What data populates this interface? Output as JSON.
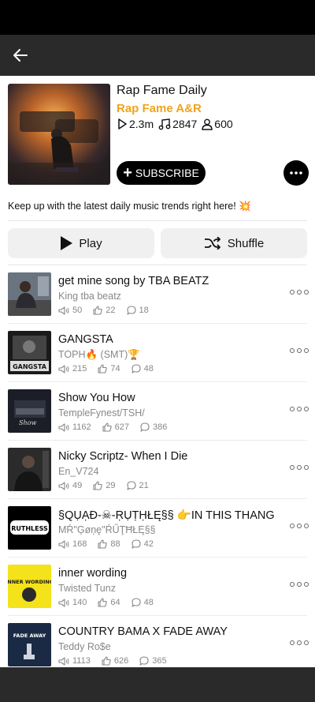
{
  "playlist": {
    "title": "Rap Fame Daily",
    "owner": "Rap Fame A&R",
    "plays": "2.3m",
    "tracks": "2847",
    "followers": "600",
    "subscribe_label": "SUBSCRIBE",
    "description": "Keep up with the latest daily music trends right here! 💥"
  },
  "actions": {
    "play_label": "Play",
    "shuffle_label": "Shuffle"
  },
  "songs": [
    {
      "title": "get mine song by TBA BEATZ",
      "artist": "King tba beatz",
      "plays": "50",
      "likes": "22",
      "comments": "18"
    },
    {
      "title": "GANGSTA",
      "artist": "TOPH🔥 (SMT)🏆",
      "plays": "215",
      "likes": "74",
      "comments": "48"
    },
    {
      "title": "Show You How",
      "artist": "TempleFynest/TSH/",
      "plays": "1162",
      "likes": "627",
      "comments": "386"
    },
    {
      "title": "Nicky Scriptz- When I Die",
      "artist": "En_V724",
      "plays": "49",
      "likes": "29",
      "comments": "21"
    },
    {
      "title": "§QỤẠĐ-☠-ṚỤṬḤŁĘ§§ 👉IN THIS THANG",
      "artist": "MŔ\"Ģøņę\"ŔŰŢĦŁĘ§§",
      "plays": "168",
      "likes": "88",
      "comments": "42"
    },
    {
      "title": "inner wording",
      "artist": "Twisted Tunz",
      "plays": "140",
      "likes": "64",
      "comments": "48"
    },
    {
      "title": "COUNTRY BAMA X FADE AWAY",
      "artist": "Teddy Ro$e",
      "plays": "1113",
      "likes": "626",
      "comments": "365"
    }
  ],
  "thumbs": {
    "s0": "GANGSTA",
    "s2": "Show",
    "s4": "RUTHLESS",
    "s5": "INNER WORDING",
    "s6": "FADE AWAY"
  },
  "colors": {
    "accent": "#f2a31b",
    "appbar": "#2a2a2a"
  },
  "icons": [
    "back-arrow-icon",
    "play-icon",
    "music-note-icon",
    "user-icon",
    "plus-icon",
    "more-icon",
    "shuffle-icon",
    "speaker-icon",
    "thumbs-up-icon",
    "comment-icon"
  ]
}
